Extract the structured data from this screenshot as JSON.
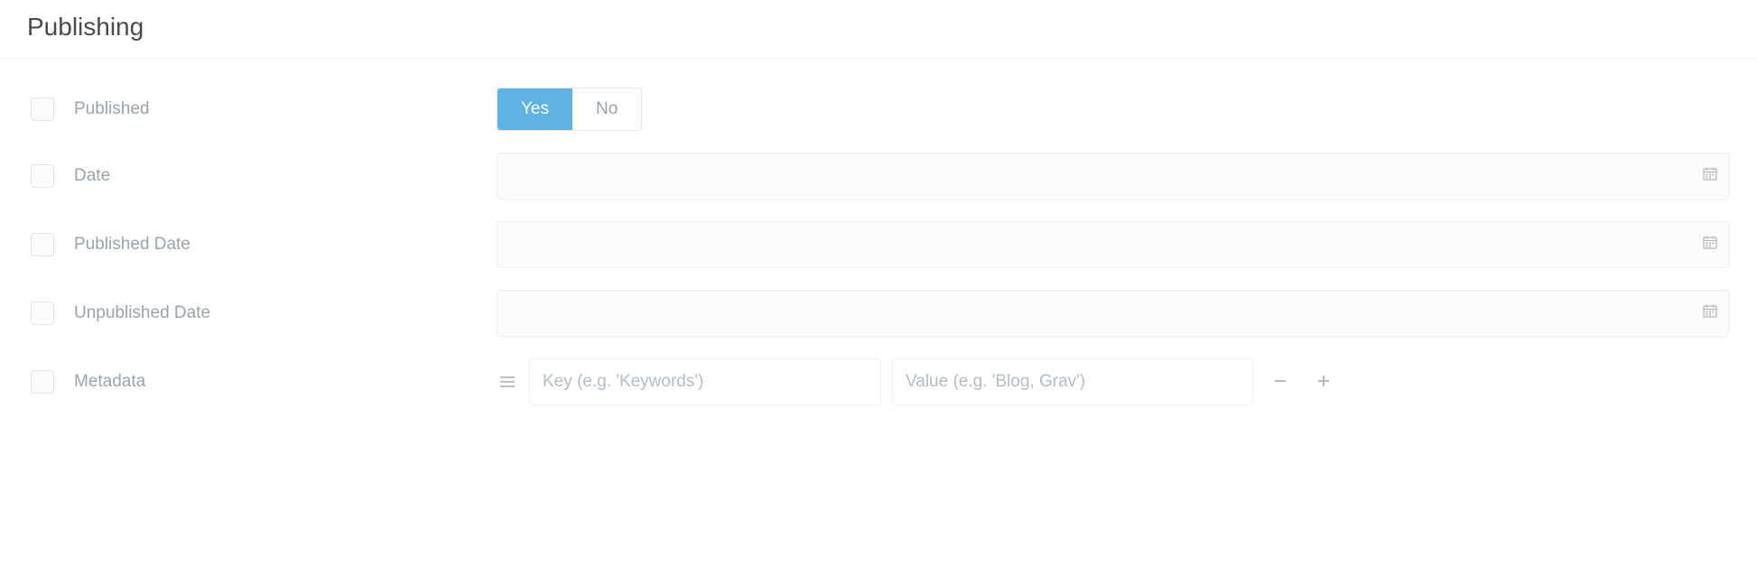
{
  "section": {
    "title": "Publishing"
  },
  "fields": {
    "published": {
      "label": "Published",
      "yes": "Yes",
      "no": "No",
      "value": "yes"
    },
    "date": {
      "label": "Date",
      "value": ""
    },
    "publishedDate": {
      "label": "Published Date",
      "value": ""
    },
    "unpublishedDate": {
      "label": "Unpublished Date",
      "value": ""
    },
    "metadata": {
      "label": "Metadata",
      "keyPlaceholder": "Key (e.g. 'Keywords')",
      "valuePlaceholder": "Value (e.g. 'Blog, Grav')",
      "keyValue": "",
      "valueValue": ""
    }
  }
}
